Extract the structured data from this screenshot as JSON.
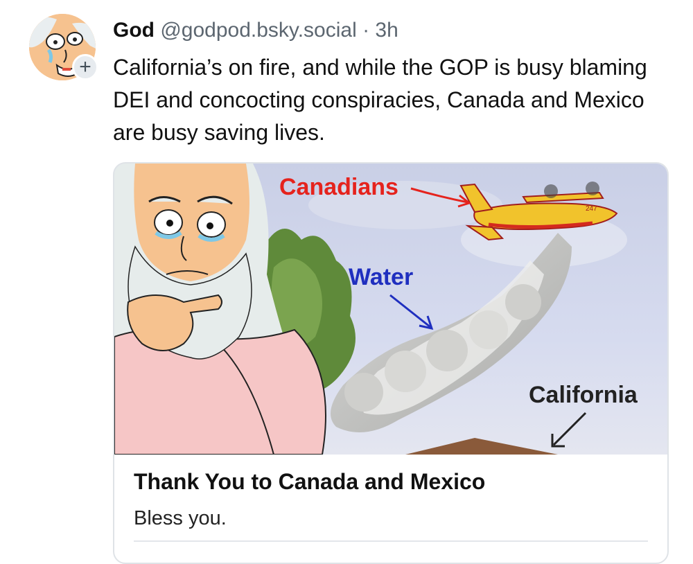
{
  "post": {
    "author_name": "God",
    "author_handle": "@godpod.bsky.social",
    "separator": "·",
    "timestamp": "3h",
    "text": "California’s on fire, and while the GOP is busy blaming DEI and concocting conspiracies, Canada and Mexico are busy saving lives.",
    "follow_badge": "+"
  },
  "link_card": {
    "image_labels": {
      "canadians": "Canadians",
      "water": "Water",
      "california": "California",
      "plane_number": "247"
    },
    "title": "Thank You to Canada and Mexico",
    "description": "Bless you."
  },
  "colors": {
    "label_red": "#e5231d",
    "label_blue": "#1f2fbf",
    "handle_gray": "#5c6670",
    "card_border": "#dfe3e7"
  },
  "icons": [
    "avatar-cartoon-god",
    "plus-icon"
  ]
}
